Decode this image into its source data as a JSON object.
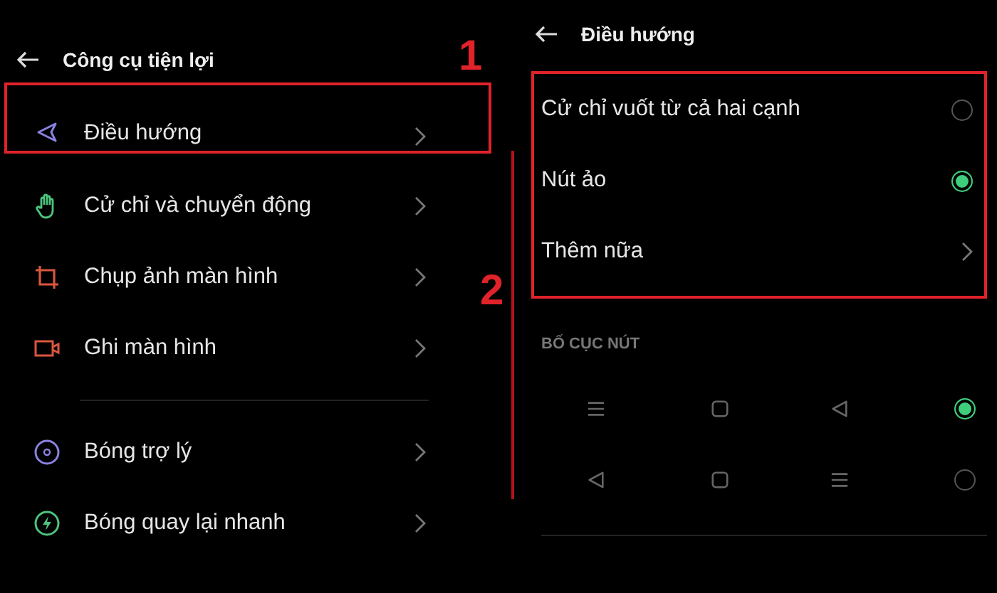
{
  "left_screen": {
    "title": "Công cụ tiện lợi",
    "groups": [
      [
        {
          "kind": "navigation",
          "label": "Điều hướng",
          "highlighted": true
        },
        {
          "kind": "gesture",
          "label": "Cử chỉ và chuyển động",
          "highlighted": false
        },
        {
          "kind": "screenshot",
          "label": "Chụp ảnh màn hình",
          "highlighted": false
        },
        {
          "kind": "record",
          "label": "Ghi màn hình",
          "highlighted": false
        }
      ],
      [
        {
          "kind": "assistant",
          "label": "Bóng trợ lý",
          "highlighted": false
        },
        {
          "kind": "quick-return",
          "label": "Bóng quay lại nhanh",
          "highlighted": false
        }
      ]
    ]
  },
  "right_screen": {
    "title": "Điều hướng",
    "options_highlighted": true,
    "options": [
      {
        "kind": "radio",
        "label": "Cử chỉ vuốt từ cả hai cạnh",
        "selected": false
      },
      {
        "kind": "radio",
        "label": "Nút ảo",
        "selected": true
      },
      {
        "kind": "link",
        "label": "Thêm nữa"
      }
    ],
    "section_title": "BỐ CỤC NÚT",
    "layouts": [
      {
        "buttons": [
          {
            "kind": "menu"
          },
          {
            "kind": "home"
          },
          {
            "kind": "back"
          }
        ],
        "selected": true
      },
      {
        "buttons": [
          {
            "kind": "back"
          },
          {
            "kind": "home"
          },
          {
            "kind": "menu"
          }
        ],
        "selected": false
      }
    ]
  },
  "annotations": [
    {
      "label": "1"
    },
    {
      "label": "2"
    }
  ]
}
